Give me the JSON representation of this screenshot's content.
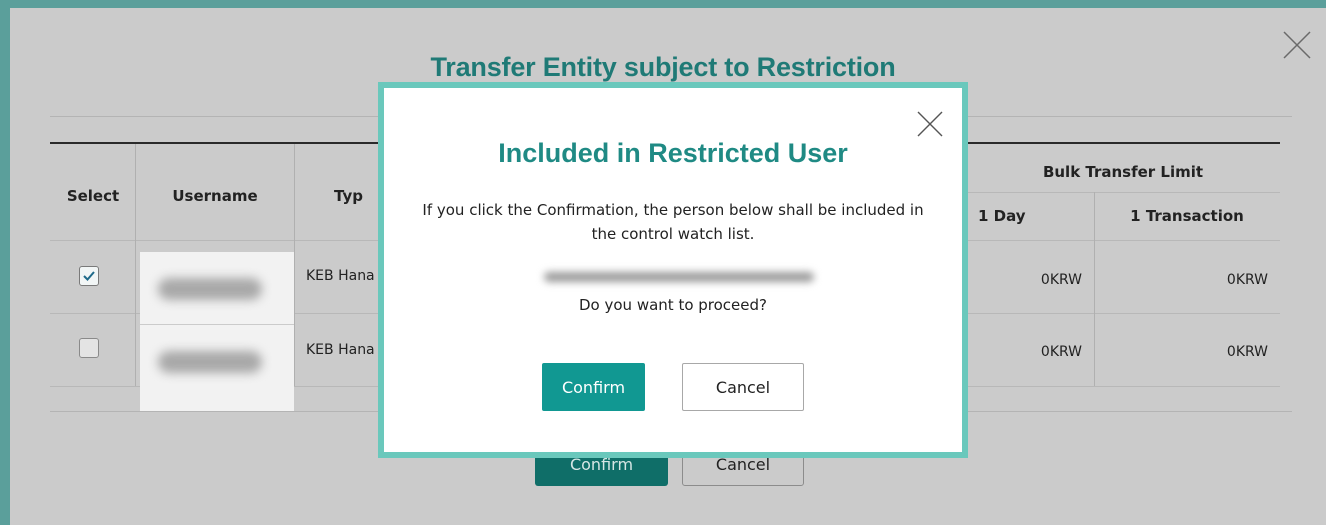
{
  "outer_dialog": {
    "title": "Transfer Entity subject to Restriction",
    "close_icon": "close-icon",
    "table": {
      "headers": {
        "select": "Select",
        "username": "Username",
        "type": "Typ",
        "bulk_transfer_limit": "Bulk Transfer Limit",
        "one_day": "1 Day",
        "one_transaction": "1 Transaction"
      },
      "rows": [
        {
          "checked": true,
          "username": "",
          "type": "KEB Hana",
          "one_day": "0KRW",
          "one_transaction": "0KRW"
        },
        {
          "checked": false,
          "username": "",
          "type": "KEB Hana",
          "one_day": "0KRW",
          "one_transaction": "0KRW"
        }
      ]
    },
    "confirm_label": "Confirm",
    "cancel_label": "Cancel"
  },
  "modal": {
    "title": "Included in Restricted User",
    "message": "If you click the Confirmation, the person below shall be included in the control watch list.",
    "question": "Do you want to proceed?",
    "confirm_label": "Confirm",
    "cancel_label": "Cancel",
    "close_icon": "close-icon"
  },
  "colors": {
    "accent": "#119892",
    "title_teal": "#1f8a84",
    "modal_border": "#6ac8bc",
    "frame": "#5b9f9b"
  }
}
